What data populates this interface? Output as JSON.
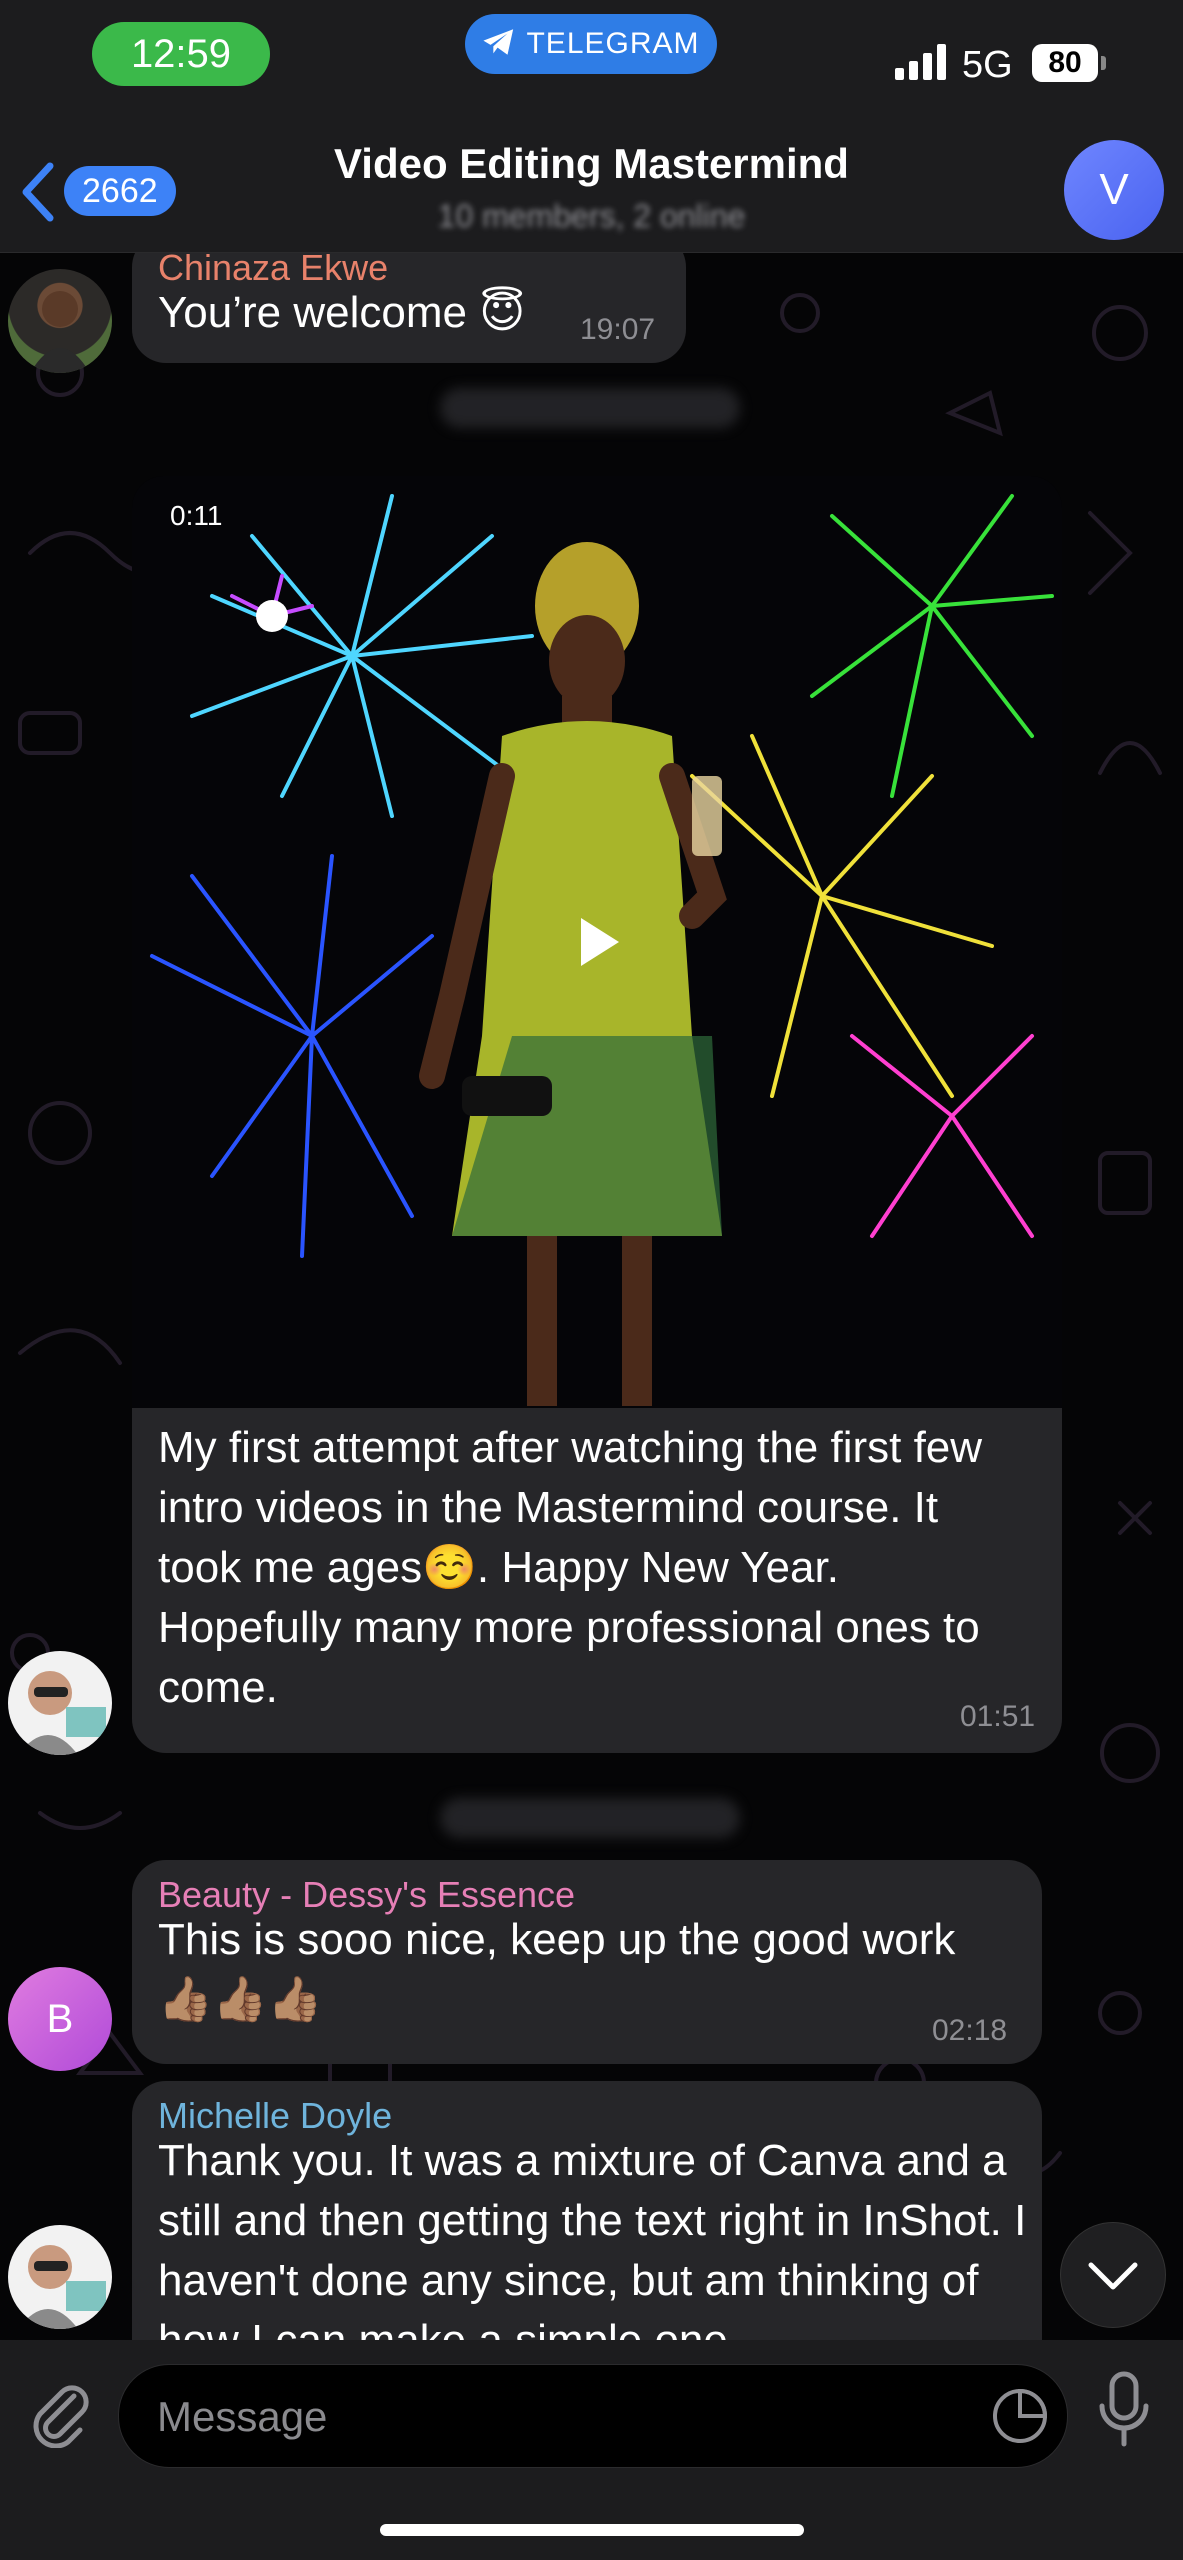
{
  "status_bar": {
    "time": "12:59",
    "app_pill": "TELEGRAM",
    "network": "5G",
    "battery": "80"
  },
  "header": {
    "back_count": "2662",
    "title": "Video Editing Mastermind",
    "subtitle": "10 members, 2 online",
    "avatar_letter": "V"
  },
  "messages": [
    {
      "sender": "Chinaza Ekwe",
      "sender_color": "#e8826b",
      "text": "You’re welcome 😇",
      "time": "19:07"
    },
    {
      "video_duration": "0:11",
      "text": "My first attempt after watching the first few intro videos in the Mastermind course. It took me ages☺️. Happy New Year. Hopefully many more professional ones to come.",
      "time": "01:51"
    },
    {
      "sender": "Beauty - Dessy's Essence",
      "sender_color": "#e67fb6",
      "avatar_letter": "B",
      "text": "This is sooo nice, keep up the good work 👍🏽👍🏽👍🏽",
      "time": "02:18"
    },
    {
      "sender": "Michelle Doyle",
      "sender_color": "#6fb4dc",
      "text": "Thank you. It was a mixture of Canva and a still and then getting the text right in InShot. I haven't done any since, but am thinking of how I can make a simple one"
    }
  ],
  "input": {
    "placeholder": "Message"
  }
}
